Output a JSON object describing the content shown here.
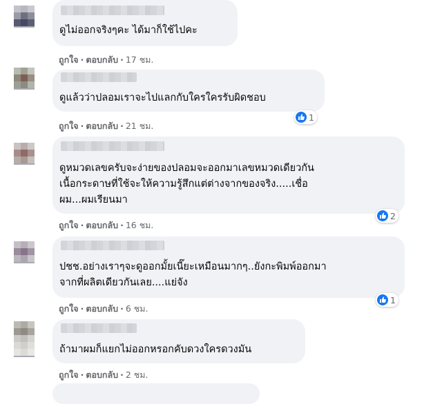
{
  "comments": [
    {
      "text": [
        "ดูไม่ออกจริงๆคะ ได้มาก็ใช้ไปคะ"
      ],
      "like": "ถูกใจ",
      "reply": "ตอบกลับ",
      "time": "17 ชม.",
      "reactions": null
    },
    {
      "text": [
        "ดูแล้วว่าปลอมเราจะไปแลกกับใครใครรับผิดชอบ"
      ],
      "like": "ถูกใจ",
      "reply": "ตอบกลับ",
      "time": "21 ชม.",
      "reactions": "1"
    },
    {
      "text": [
        "ดูหมวดเลขครับจะง่ายของปลอมจะออกมาเลขหมวดเดียวกัน",
        "เนื้อกระดาษที่ใช้จะให้ความรู้สึกแต่ต่างจากของจริง.....เชื่อ",
        "ผม...ผมเรียนมา"
      ],
      "like": "ถูกใจ",
      "reply": "ตอบกลับ",
      "time": "16 ชม.",
      "reactions": "2"
    },
    {
      "text": [
        "ปชช.อย่างเราๆจะดูออกมั้ยเนี๊ยะเหมือนมากๆ..ยังกะพิมพ์ออกมา",
        "จากที่ผลิตเดียวกันเลย....แย่จัง"
      ],
      "like": "ถูกใจ",
      "reply": "ตอบกลับ",
      "time": "6 ชม.",
      "reactions": "1"
    },
    {
      "text": [
        "ถ้ามาผมก็แยกไม่ออกหรอกคับดวงใครดวงมัน"
      ],
      "like": "ถูกใจ",
      "reply": "ตอบกลับ",
      "time": "2 ชม.",
      "reactions": null
    }
  ],
  "separator": "·",
  "colors": {
    "bubble": "#f0f2f5",
    "meta": "#65676b",
    "like_blue": "#1877f2"
  },
  "icons": {
    "reaction": "thumbs-up-icon"
  }
}
